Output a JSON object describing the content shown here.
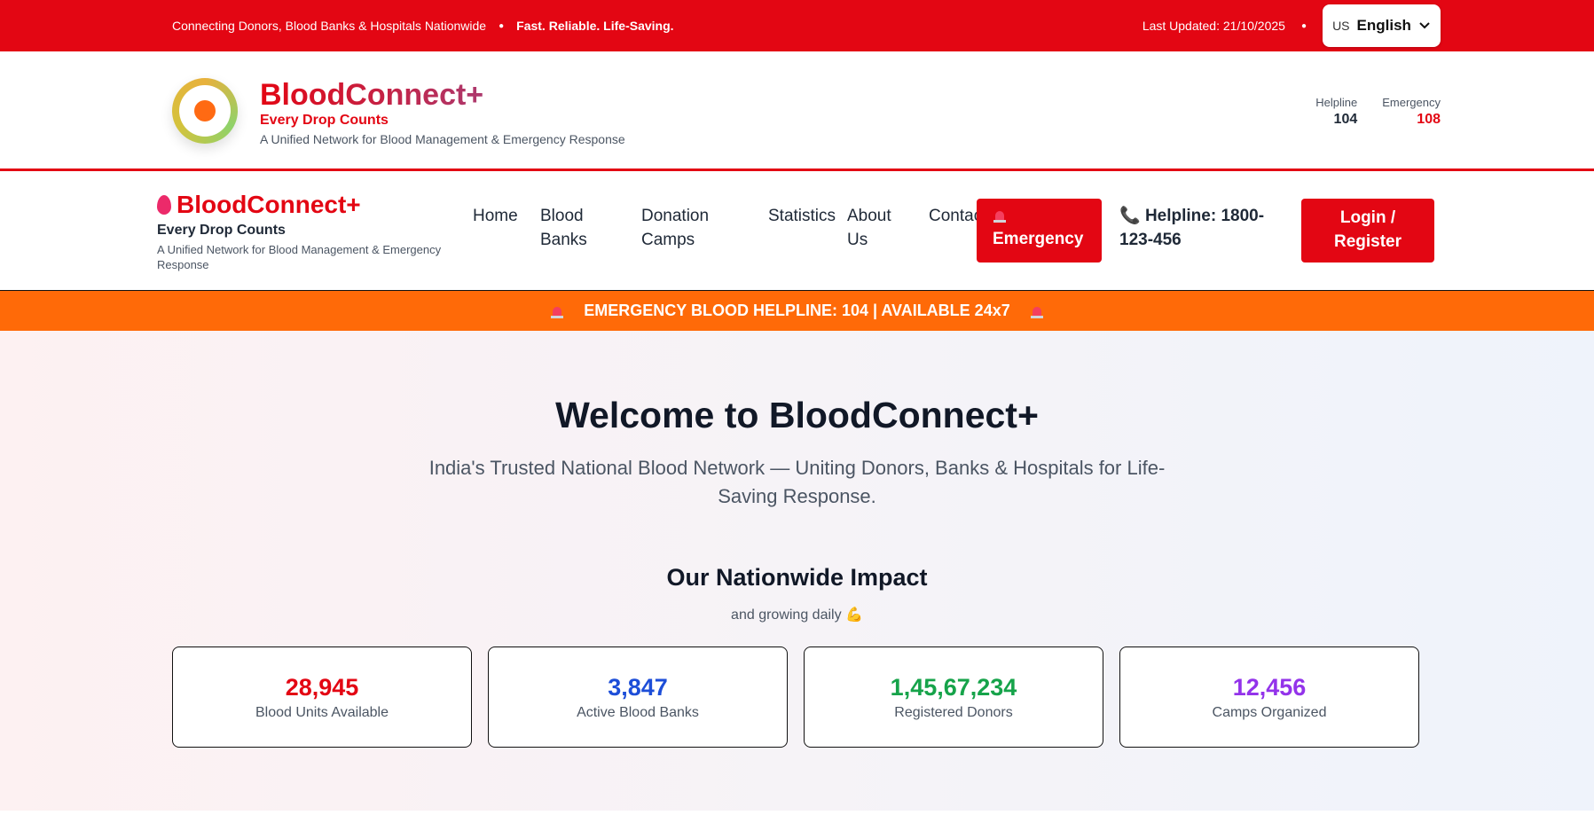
{
  "topbar": {
    "tagline": "Connecting Donors, Blood Banks & Hospitals Nationwide",
    "motto": "Fast. Reliable. Life-Saving.",
    "last_updated": "Last Updated: 21/10/2025",
    "lang_code": "US",
    "lang_name": "English"
  },
  "brand": {
    "title": "BloodConnect+",
    "tagline": "Every Drop Counts",
    "subtitle": "A Unified Network for Blood Management & Emergency Response",
    "helpline_label": "Helpline",
    "helpline_value": "104",
    "emergency_label": "Emergency",
    "emergency_value": "108"
  },
  "nav": {
    "logo_title": "BloodConnect+",
    "logo_tag": "Every Drop Counts",
    "logo_sub": "A Unified Network for Blood Management & Emergency Response",
    "links": [
      "Home",
      "Blood Banks",
      "Donation Camps",
      "Statistics",
      "About Us",
      "Contact"
    ],
    "emergency_button": "Emergency",
    "helpline": "Helpline: 1800-123-456",
    "login_button": "Login / Register"
  },
  "banner": {
    "text": "EMERGENCY BLOOD HELPLINE: 104 | AVAILABLE 24x7"
  },
  "hero": {
    "title": "Welcome to BloodConnect+",
    "lead": "India's Trusted National Blood Network — Uniting Donors, Banks & Hospitals for Life-Saving Response.",
    "impact_title": "Our Nationwide Impact",
    "impact_sub": "and growing daily 💪"
  },
  "stats": [
    {
      "value": "28,945",
      "label": "Blood Units Available",
      "color": "#e30613"
    },
    {
      "value": "3,847",
      "label": "Active Blood Banks",
      "color": "#1d4ed8"
    },
    {
      "value": "1,45,67,234",
      "label": "Registered Donors",
      "color": "#16a34a"
    },
    {
      "value": "12,456",
      "label": "Camps Organized",
      "color": "#9333ea"
    }
  ]
}
